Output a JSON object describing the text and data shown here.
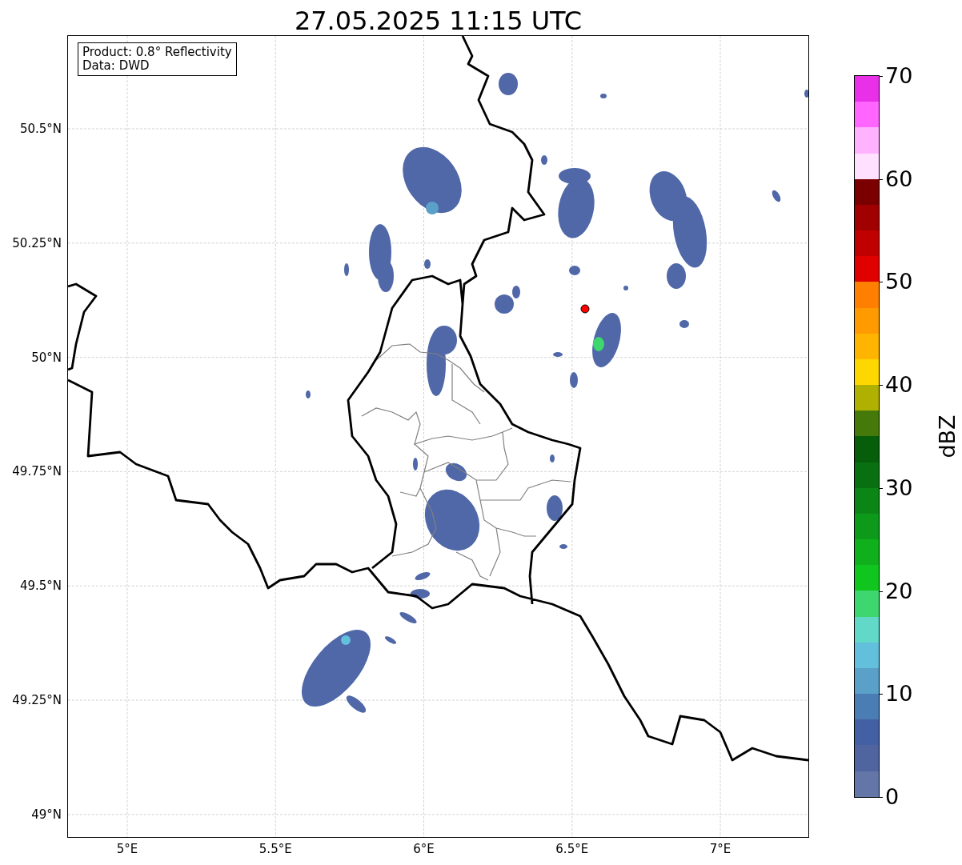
{
  "title": "27.05.2025 11:15 UTC",
  "info_box": {
    "lines": [
      "Product: 0.8° Reflectivity",
      "Data: DWD"
    ]
  },
  "map": {
    "y_ticks": [
      "50.5°N",
      "50.25°N",
      "50°N",
      "49.75°N",
      "49.5°N",
      "49.25°N",
      "49°N"
    ],
    "x_ticks": [
      "5°E",
      "5.5°E",
      "6°E",
      "6.5°E",
      "7°E"
    ]
  },
  "colorbar": {
    "label": "dBZ",
    "ticks": [
      "70",
      "60",
      "50",
      "40",
      "30",
      "20",
      "10",
      "0"
    ],
    "segments": [
      {
        "color": "#e930e9"
      },
      {
        "color": "#ff66ff"
      },
      {
        "color": "#ffb3ff"
      },
      {
        "color": "#ffe0ff"
      },
      {
        "color": "#7a0000"
      },
      {
        "color": "#a00000"
      },
      {
        "color": "#c00000"
      },
      {
        "color": "#e00000"
      },
      {
        "color": "#ff7f00"
      },
      {
        "color": "#ff9a00"
      },
      {
        "color": "#ffb400"
      },
      {
        "color": "#ffd700"
      },
      {
        "color": "#b0b000"
      },
      {
        "color": "#457a0a"
      },
      {
        "color": "#065e0a"
      },
      {
        "color": "#087010"
      },
      {
        "color": "#0b8516"
      },
      {
        "color": "#0d9a1a"
      },
      {
        "color": "#0fb01c"
      },
      {
        "color": "#10c51e"
      },
      {
        "color": "#3ed66e"
      },
      {
        "color": "#62d8c8"
      },
      {
        "color": "#62c0dc"
      },
      {
        "color": "#5aa0c8"
      },
      {
        "color": "#4a7db4"
      },
      {
        "color": "#4460a4"
      },
      {
        "color": "#50659f"
      },
      {
        "color": "#6476a8"
      }
    ]
  }
}
